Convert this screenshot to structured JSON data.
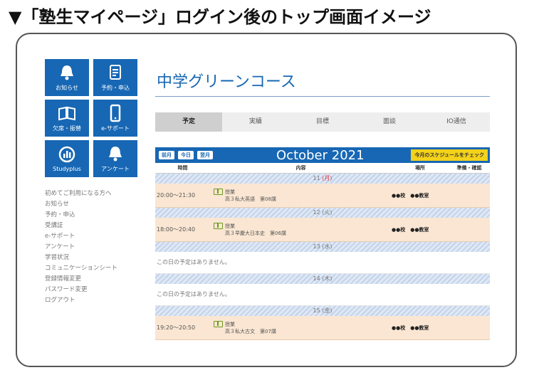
{
  "heading": "▼「塾生マイページ」ログイン後のトップ画面イメージ",
  "sidebar": {
    "tiles": [
      {
        "label": "お知らせ",
        "icon": "bell-icon"
      },
      {
        "label": "予約・申込",
        "icon": "form-icon"
      },
      {
        "label": "欠席・振替",
        "icon": "book-icon"
      },
      {
        "label": "e-サポート",
        "icon": "tablet-icon"
      },
      {
        "label": "Studyplus",
        "icon": "chart-icon"
      },
      {
        "label": "アンケート",
        "icon": "bell-icon"
      }
    ],
    "links": [
      "初めてご利用になる方へ",
      "お知らせ",
      "予約・申込",
      "受講証",
      "e-サポート",
      "アンケート",
      "学習状況",
      "コミュニケーションシート",
      "登録情報変更",
      "パスワード変更",
      "ログアウト"
    ]
  },
  "main": {
    "course_title": "中学グリーンコース",
    "tabs": [
      "予定",
      "実績",
      "目標",
      "面談",
      "IO通信"
    ],
    "calendar": {
      "nav": [
        "前月",
        "今日",
        "翌月"
      ],
      "month": "October 2021",
      "check_button": "今月のスケジュールをチェック",
      "columns": [
        "時間",
        "内容",
        "場所",
        "準備・確認"
      ],
      "days": [
        {
          "date": "11",
          "weekday": "(月)",
          "time": "20:00～21:30",
          "type": "授業",
          "detail": "高３私大英語　第08講",
          "place": "●●校　●●教室"
        },
        {
          "date": "12",
          "weekday": "(火)",
          "time": "18:00～20:40",
          "type": "授業",
          "detail": "高３早慶大日本史　第06講",
          "place": "●●校　●●教室"
        },
        {
          "date": "13",
          "weekday": "(水)",
          "none": "この日の予定はありません。"
        },
        {
          "date": "14",
          "weekday": "(木)",
          "none": "この日の予定はありません。"
        },
        {
          "date": "15",
          "weekday": "(金)",
          "time": "19:20～20:50",
          "type": "授業",
          "detail": "高３私大古文　第07講",
          "place": "●●校　●●教室"
        }
      ]
    }
  }
}
